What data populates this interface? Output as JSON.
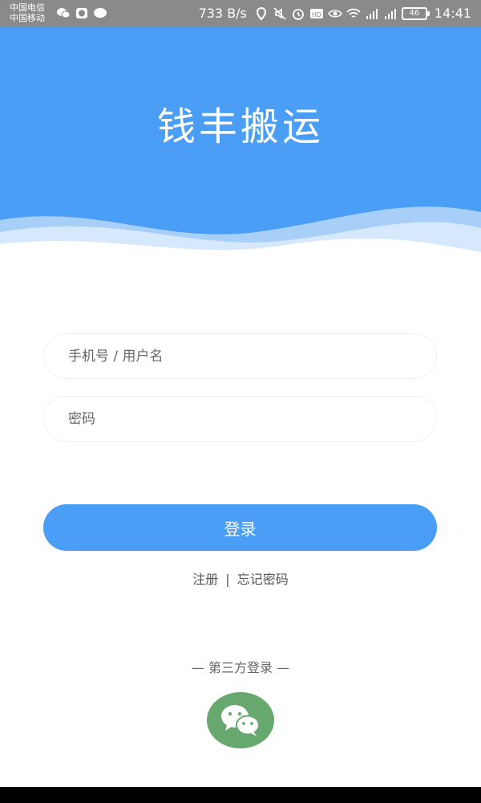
{
  "status_bar": {
    "carrier_1": "中国电信",
    "carrier_2": "中国移动",
    "speed": "733 B/s",
    "battery": "46",
    "time": "14:41",
    "icons": [
      "wechat-icon",
      "app-icon",
      "message-icon",
      "location-icon",
      "mute-icon",
      "alarm-icon",
      "hd-icon",
      "eye-icon",
      "wifi-icon",
      "signal-2g-icon",
      "signal-4g-icon",
      "battery-icon"
    ]
  },
  "header": {
    "title": "钱丰搬运",
    "color": "#4a9ef5"
  },
  "form": {
    "username_placeholder": "手机号 / 用户名",
    "password_placeholder": "密码",
    "login_label": "登录"
  },
  "links": {
    "register": "注册",
    "separator": "|",
    "forgot": "忘记密码"
  },
  "third_party": {
    "label": "— 第三方登录 —",
    "wechat_icon": "wechat-icon",
    "wechat_color": "#66a86e"
  }
}
